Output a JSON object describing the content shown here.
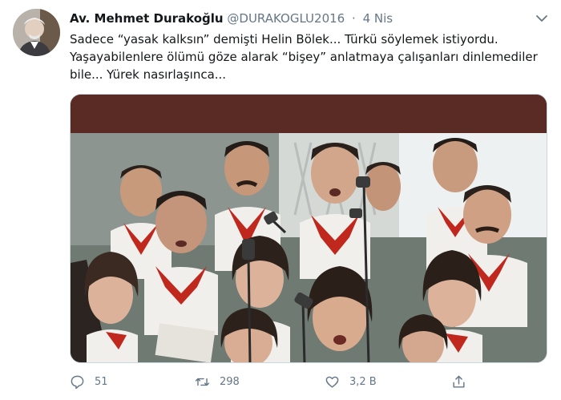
{
  "tweet": {
    "author_name": "Av. Mehmet Durakoğlu",
    "handle": "@DURAKOGLU2016",
    "separator": "·",
    "date": "4 Nis",
    "text": "Sadece “yasak kalksın” demişti Helin Bölek... Türkü söylemek istiyordu. Yaşayabilenlere ölümü göze alarak “bişey” anlatmaya çalışanları dinlemediler bile... Yürek nasırlaşınca...",
    "media_alt": "choir-photo"
  },
  "actions": {
    "reply_count": "51",
    "retweet_count": "298",
    "like_count": "3,2 B"
  },
  "icons": {
    "caret": "chevron-down-icon",
    "reply": "reply-icon",
    "retweet": "retweet-icon",
    "like": "heart-icon",
    "share": "share-icon"
  },
  "colors": {
    "text": "#14171a",
    "secondary": "#657786",
    "banner": "#5a2a24",
    "scarf": "#c0281e"
  }
}
